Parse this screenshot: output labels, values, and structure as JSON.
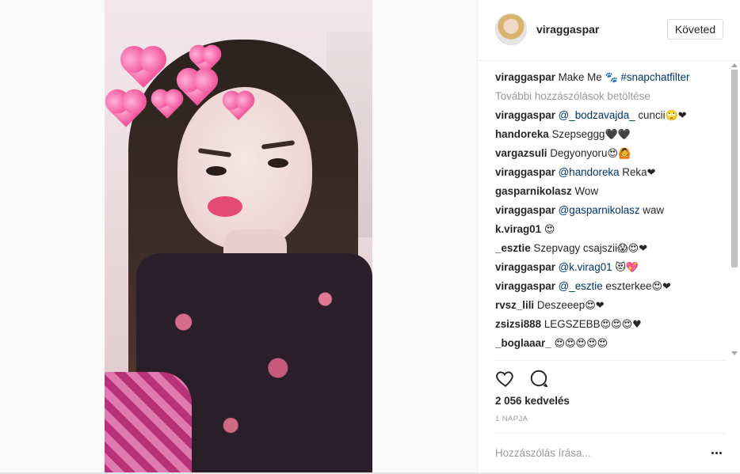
{
  "post": {
    "username": "viraggaspar",
    "follow_button": "Követed",
    "caption": {
      "user": "viraggaspar",
      "text": "Make Me",
      "emoji": "🐾",
      "hashtag": "#snapchatfilter"
    },
    "load_more": "További hozzászólások betöltése",
    "comments": [
      {
        "user": "viraggaspar",
        "mention": "@_bodzavajda_",
        "text": " cuncii",
        "emoji": "🙄❤"
      },
      {
        "user": "handoreka",
        "mention": "",
        "text": "Szepseggg",
        "emoji": "🖤🖤"
      },
      {
        "user": "vargazsuli",
        "mention": "",
        "text": "Degyonyoru",
        "emoji": "😍🙆"
      },
      {
        "user": "viraggaspar",
        "mention": "@handoreka",
        "text": " Reka",
        "emoji": "❤"
      },
      {
        "user": "gasparnikolasz",
        "mention": "",
        "text": "Wow",
        "emoji": ""
      },
      {
        "user": "viraggaspar",
        "mention": "@gasparnikolasz",
        "text": " waw",
        "emoji": ""
      },
      {
        "user": "k.virag01",
        "mention": "",
        "text": "",
        "emoji": "😍"
      },
      {
        "user": "_esztie",
        "mention": "",
        "text": "Szepvagy csajszii",
        "emoji": "😱😍❤"
      },
      {
        "user": "viraggaspar",
        "mention": "@k.virag01",
        "text": " ",
        "emoji": "😻💖"
      },
      {
        "user": "viraggaspar",
        "mention": "@_esztie",
        "text": " eszterkee",
        "emoji": "😍❤"
      },
      {
        "user": "rvsz_lili",
        "mention": "",
        "text": "Deszeeep",
        "emoji": "😍❤"
      },
      {
        "user": "zsizsi888",
        "mention": "",
        "text": "LEGSZEBB",
        "emoji": "😍😍😍♥"
      },
      {
        "user": "_boglaaar_",
        "mention": "",
        "text": "",
        "emoji": "😍😍😍😍😍"
      }
    ],
    "likes": "2 056 kedvelés",
    "time_ago": "1 NAPJA",
    "comment_placeholder": "Hozzászólás írása..."
  },
  "colors": {
    "link": "#003569",
    "muted": "#999999",
    "text": "#262626",
    "heart_filter": "#f1559c"
  },
  "icons": {
    "like": "heart-outline-icon",
    "comment": "speech-bubble-icon",
    "more": "more-dots-icon"
  }
}
